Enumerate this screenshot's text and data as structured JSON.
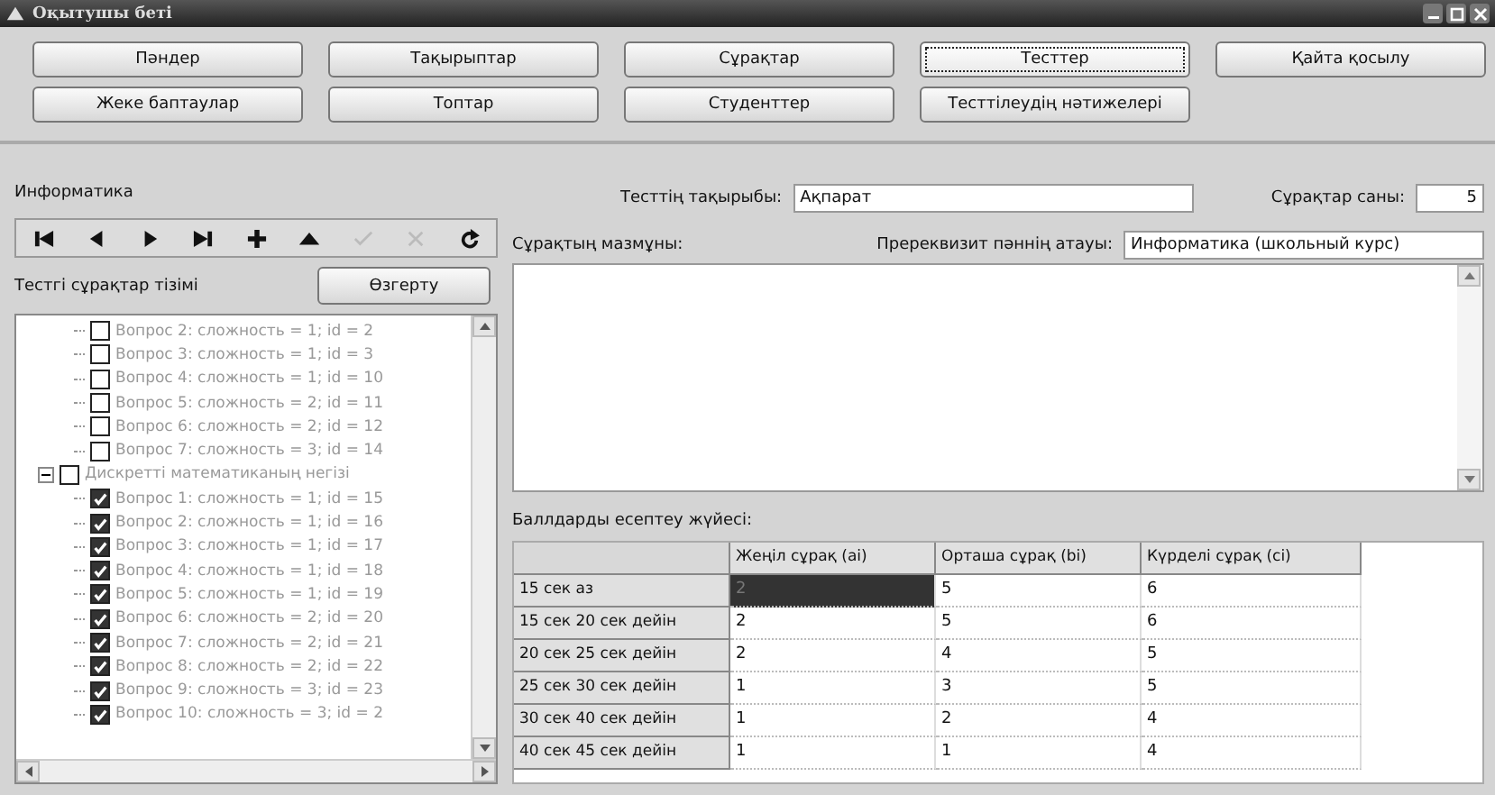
{
  "window": {
    "title": "Оқытушы беті"
  },
  "menu_buttons": [
    {
      "label": "Пәндер",
      "selected": false
    },
    {
      "label": "Тақырыптар",
      "selected": false
    },
    {
      "label": "Сұрақтар",
      "selected": false
    },
    {
      "label": "Тесттер",
      "selected": true
    },
    {
      "label": "Қайта қосылу",
      "selected": false
    },
    {
      "label": "Жеке баптаулар",
      "selected": false
    },
    {
      "label": "Топтар",
      "selected": false
    },
    {
      "label": "Студенттер",
      "selected": false
    },
    {
      "label": "Тесттілеудің нәтижелері",
      "selected": false
    }
  ],
  "left_panel": {
    "subject": "Информатика",
    "navigator": [
      {
        "kind": "first",
        "disabled": false
      },
      {
        "kind": "prior",
        "disabled": false
      },
      {
        "kind": "next",
        "disabled": false
      },
      {
        "kind": "last",
        "disabled": false
      },
      {
        "kind": "insert",
        "disabled": false
      },
      {
        "kind": "up",
        "disabled": false
      },
      {
        "kind": "post",
        "disabled": true
      },
      {
        "kind": "cancel",
        "disabled": true
      },
      {
        "kind": "refresh",
        "disabled": false
      }
    ],
    "tree_label": "Тестгі сұрақтар тізімі",
    "expand_button": "Өзгерту",
    "tree": [
      {
        "label": "Вопрос 2: сложность = 1; id = 2",
        "checked": false
      },
      {
        "label": "Вопрос 3: сложность = 1; id = 3",
        "checked": false
      },
      {
        "label": "Вопрос 4: сложность = 1; id = 10",
        "checked": false
      },
      {
        "label": "Вопрос 5: сложность = 2; id = 11",
        "checked": false
      },
      {
        "label": "Вопрос 6: сложность = 2; id = 12",
        "checked": false
      },
      {
        "label": "Вопрос 7: сложность = 3; id = 14",
        "checked": false
      },
      {
        "label": "Дискретті математиканың негізі",
        "checked": false,
        "expanded": true,
        "children": [
          {
            "label": "Вопрос 1: сложность = 1; id = 15",
            "checked": true
          },
          {
            "label": "Вопрос 2: сложность = 1; id = 16",
            "checked": true
          },
          {
            "label": "Вопрос 3: сложность = 1; id = 17",
            "checked": true
          },
          {
            "label": "Вопрос 4: сложность = 1; id = 18",
            "checked": true
          },
          {
            "label": "Вопрос 5: сложность = 1; id = 19",
            "checked": true
          },
          {
            "label": "Вопрос 6: сложность = 2; id = 20",
            "checked": true
          },
          {
            "label": "Вопрос 7: сложность = 2; id = 21",
            "checked": true
          },
          {
            "label": "Вопрос 8: сложность = 2; id = 22",
            "checked": true
          },
          {
            "label": "Вопрос 9: сложность = 3; id = 23",
            "checked": true
          },
          {
            "label": "Вопрос 10: сложность = 3; id = 2",
            "checked": true
          }
        ]
      }
    ]
  },
  "form": {
    "topic_label": "Тесттің тақырыбы:",
    "topic_value": "Ақпарат",
    "count_label": "Сұрақтар саны:",
    "count_value": "5",
    "content_label": "Сұрақтың мазмұны:",
    "prereq_label": "Пререквизит пәннің атауы:",
    "prereq_value": "Информатика (школьный курс)"
  },
  "scoring": {
    "title": "Баллдарды есептеу жүйесі:",
    "columns": [
      "Жеңіл сұрақ (ai)",
      "Орташа сұрақ (bi)",
      "Күрделі сұрақ (ci)"
    ],
    "rows": [
      {
        "label": "15 сек аз",
        "cells": [
          {
            "text": "2",
            "selected": true
          },
          {
            "text": "5",
            "selected": false
          },
          {
            "text": "6",
            "selected": false
          }
        ]
      },
      {
        "label": "15 сек 20 сек дейін",
        "cells": [
          {
            "text": "2",
            "selected": false
          },
          {
            "text": "5",
            "selected": false
          },
          {
            "text": "6",
            "selected": false
          }
        ]
      },
      {
        "label": "20 сек 25 сек дейін",
        "cells": [
          {
            "text": "2",
            "selected": false
          },
          {
            "text": "4",
            "selected": false
          },
          {
            "text": "5",
            "selected": false
          }
        ]
      },
      {
        "label": "25 сек 30 сек дейін",
        "cells": [
          {
            "text": "1",
            "selected": false
          },
          {
            "text": "3",
            "selected": false
          },
          {
            "text": "5",
            "selected": false
          }
        ]
      },
      {
        "label": "30 сек 40 сек дейін",
        "cells": [
          {
            "text": "1",
            "selected": false
          },
          {
            "text": "2",
            "selected": false
          },
          {
            "text": "4",
            "selected": false
          }
        ]
      },
      {
        "label": "40 сек 45 сек дейін",
        "cells": [
          {
            "text": "1",
            "selected": false
          },
          {
            "text": "1",
            "selected": false
          },
          {
            "text": "4",
            "selected": false
          }
        ]
      }
    ]
  }
}
